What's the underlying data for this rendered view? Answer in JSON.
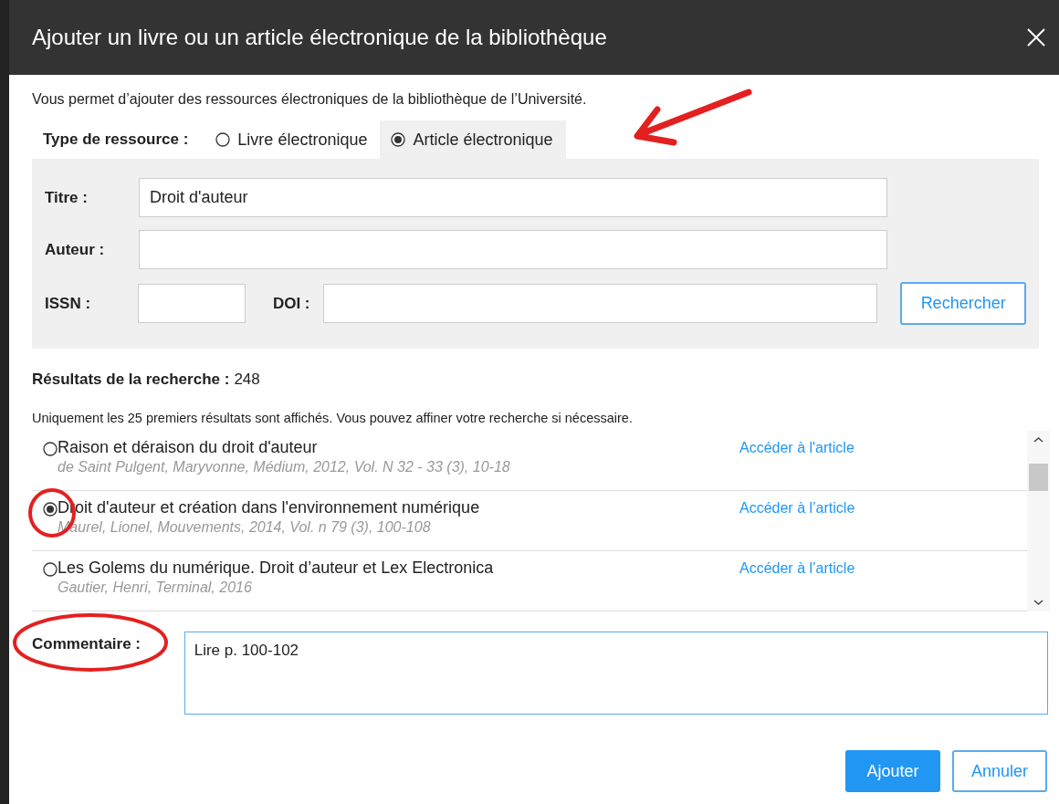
{
  "dialog": {
    "title": "Ajouter un livre ou un article électronique de la bibliothèque"
  },
  "description": "Vous permet d’ajouter des ressources électroniques de la bibliothèque de l’Université.",
  "resource_type": {
    "label": "Type de ressource :",
    "options": [
      {
        "label": "Livre électronique",
        "selected": false
      },
      {
        "label": "Article électronique",
        "selected": true
      }
    ]
  },
  "form": {
    "title_field": {
      "label": "Titre :",
      "value": "Droit d'auteur"
    },
    "author_field": {
      "label": "Auteur :"
    },
    "issn_field": {
      "label": "ISSN :"
    },
    "doi_field": {
      "label": "DOI :"
    },
    "search_button": "Rechercher"
  },
  "results": {
    "label": "Résultats de la recherche :",
    "count": "248",
    "note": "Uniquement les 25 premiers résultats sont affichés. Vous pouvez affiner votre recherche si nécessaire.",
    "items": [
      {
        "title": "Raison et déraison du droit d'auteur",
        "details": "de Saint Pulgent, Maryvonne, Médium, 2012, Vol. N 32 - 33 (3), 10-18",
        "link": "Accéder à l'article",
        "selected": false
      },
      {
        "title": "Droit d'auteur et création dans l'environnement numérique",
        "details": "Maurel, Lionel, Mouvements, 2014, Vol. n 79 (3), 100-108",
        "link": "Accéder à l’article",
        "selected": true
      },
      {
        "title": "Les Golems du numérique. Droit d’auteur et Lex Electronica",
        "details": "Gautier, Henri, Terminal, 2016",
        "link": "Accéder à l’article",
        "selected": false
      }
    ]
  },
  "comment": {
    "label": "Commentaire :",
    "value": "Lire p. 100-102"
  },
  "buttons": {
    "primary": "Ajouter",
    "secondary": "Annuler"
  }
}
